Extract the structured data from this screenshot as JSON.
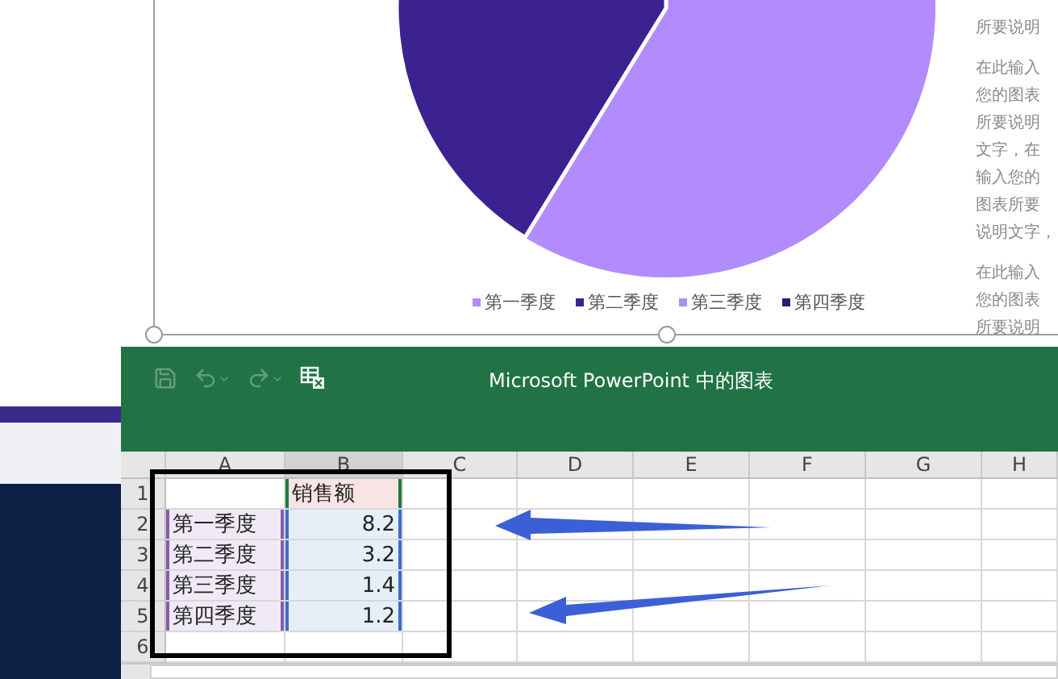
{
  "slide": {
    "paragraphs": [
      {
        "lines": [
          "所要说明"
        ]
      },
      {
        "lines": [
          "在此输入",
          "您的图表",
          "所要说明",
          "文字，在",
          "输入您的",
          "图表所要",
          "说明文字，"
        ]
      },
      {
        "lines": [
          "在此输入",
          "您的图表",
          "所要说明"
        ]
      }
    ],
    "legend": [
      {
        "label": "第一季度",
        "color": "#b28cfc"
      },
      {
        "label": "第二季度",
        "color": "#3c2290"
      },
      {
        "label": "第三季度",
        "color": "#a992ea"
      },
      {
        "label": "第四季度",
        "color": "#2c1a6e"
      }
    ]
  },
  "chart_window": {
    "title": "Microsoft PowerPoint 中的图表",
    "toolbar": [
      {
        "kind": "save",
        "disabled": true
      },
      {
        "kind": "undo",
        "disabled": true
      },
      {
        "kind": "redo",
        "disabled": true
      },
      {
        "kind": "edit_data",
        "disabled": false
      }
    ]
  },
  "sheet": {
    "columns": [
      {
        "label": "A",
        "selected": false
      },
      {
        "label": "B",
        "selected": true
      },
      {
        "label": "C",
        "selected": false
      },
      {
        "label": "D",
        "selected": false
      },
      {
        "label": "E",
        "selected": false
      },
      {
        "label": "F",
        "selected": false
      },
      {
        "label": "G",
        "selected": false
      },
      {
        "label": "H",
        "selected": false
      }
    ],
    "rows": [
      {
        "header": "1",
        "cells": [
          {
            "kind": "blank"
          },
          {
            "text": "销售额",
            "kind": "series"
          }
        ]
      },
      {
        "header": "2",
        "cells": [
          {
            "text": "第一季度",
            "kind": "category"
          },
          {
            "text": "8.2",
            "kind": "value"
          }
        ]
      },
      {
        "header": "3",
        "cells": [
          {
            "text": "第二季度",
            "kind": "category"
          },
          {
            "text": "3.2",
            "kind": "value"
          }
        ]
      },
      {
        "header": "4",
        "cells": [
          {
            "text": "第三季度",
            "kind": "category"
          },
          {
            "text": "1.4",
            "kind": "value"
          }
        ]
      },
      {
        "header": "5",
        "cells": [
          {
            "text": "第四季度",
            "kind": "category"
          },
          {
            "text": "1.2",
            "kind": "value"
          }
        ]
      },
      {
        "header": "6",
        "cells": []
      }
    ]
  }
}
